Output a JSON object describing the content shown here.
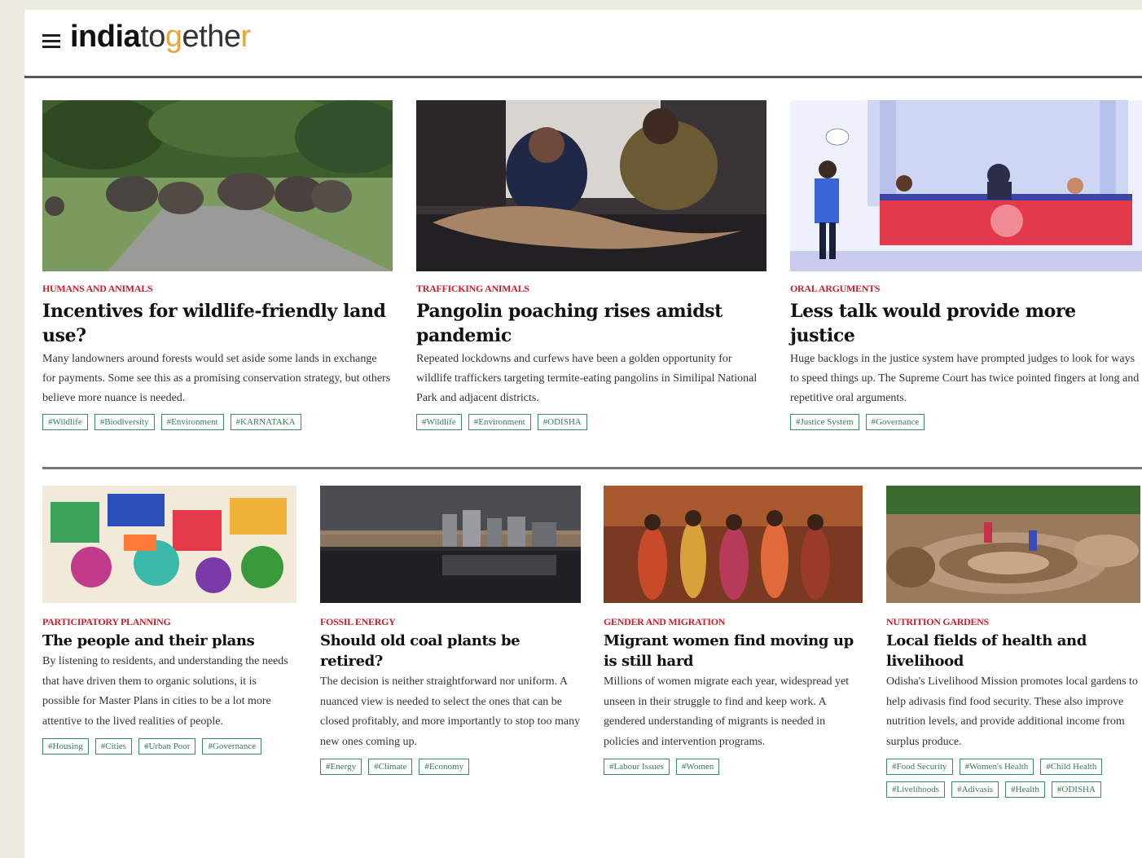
{
  "header": {
    "logo_part1": "india",
    "logo_part2": "to",
    "logo_part3": "g",
    "logo_part4": "ethe",
    "logo_part5": "r"
  },
  "articles_row1": [
    {
      "category": "HUMANS AND ANIMALS",
      "title": "Incentives for wildlife-friendly land use?",
      "summary": "Many landowners around forests would set aside some lands in exchange for payments. Some see this as a promising conservation strategy, but others believe more nuance is needed.",
      "tags": [
        "#Wildlife",
        "#Biodiversity",
        "#Environment",
        "#KARNATAKA"
      ]
    },
    {
      "category": "TRAFFICKING ANIMALS",
      "title": "Pangolin poaching rises amidst pandemic",
      "summary": "Repeated lockdowns and curfews have been a golden opportunity for wildlife traffickers targeting termite-eating pangolins in Similipal National Park and adjacent districts.",
      "tags": [
        "#Wildlife",
        "#Environment",
        "#ODISHA"
      ]
    },
    {
      "category": "ORAL ARGUMENTS",
      "title": "Less talk would provide more justice",
      "summary": "Huge backlogs in the justice system have prompted judges to look for ways to speed things up. The Supreme Court has twice pointed fingers at long and repetitive oral arguments.",
      "tags": [
        "#Justice System",
        "#Governance"
      ]
    }
  ],
  "articles_row2": [
    {
      "category": "PARTICIPATORY PLANNING",
      "title": "The people and their plans",
      "summary": "By listening to residents, and understanding the needs that have driven them to organic solutions, it is possible for Master Plans in cities to be a lot more attentive to the lived realities of people.",
      "tags": [
        "#Housing",
        "#Cities",
        "#Urban Poor",
        "#Governance"
      ]
    },
    {
      "category": "FOSSIL ENERGY",
      "title": "Should old coal plants be retired?",
      "summary": "The decision is neither straightforward nor uniform. A nuanced view is needed to select the ones that can be closed profitably, and more importantly to stop too many new ones coming up.",
      "tags": [
        "#Energy",
        "#Climate",
        "#Economy"
      ]
    },
    {
      "category": "GENDER AND MIGRATION",
      "title": "Migrant women find moving up is still hard",
      "summary": "Millions of women migrate each year, widespread yet unseen in their struggle to find and keep work. A gendered understanding of migrants is needed in policies and intervention programs.",
      "tags": [
        "#Labour Issues",
        "#Women"
      ]
    },
    {
      "category": "NUTRITION GARDENS",
      "title": "Local fields of health and livelihood",
      "summary": "Odisha's Livelihood Mission promotes local gardens to help adivasis find food security. These also improve nutrition levels, and provide additional income from surplus produce.",
      "tags": [
        "#Food Security",
        "#Women's Health",
        "#Child Health",
        "#Livelihoods",
        "#Adivasis",
        "#Health",
        "#ODISHA"
      ]
    }
  ],
  "colors": {
    "category_red": "#c8202a",
    "tag_green": "#3a8a5a",
    "logo_accent": "#e8a33a"
  }
}
